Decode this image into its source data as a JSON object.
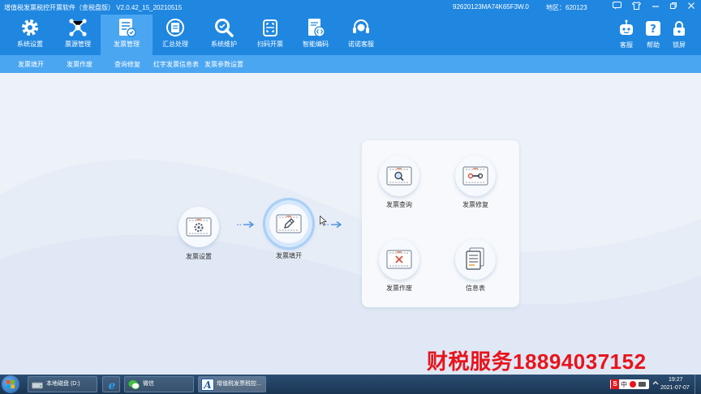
{
  "titlebar": {
    "title": "增值税发票税控开票软件（金税盘版） V2.0.42_15_20210515",
    "tax_id": "92620123MA74K65F3W.0",
    "region": "地区：620123"
  },
  "toolbar": {
    "items": [
      {
        "label": "系统设置",
        "icon": "gear-icon"
      },
      {
        "label": "票源管理",
        "icon": "network-icon"
      },
      {
        "label": "发票管理",
        "icon": "invoice-icon"
      },
      {
        "label": "汇总处理",
        "icon": "summary-icon"
      },
      {
        "label": "系统维护",
        "icon": "wrench-icon"
      },
      {
        "label": "扫码开票",
        "icon": "scan-icon"
      },
      {
        "label": "智能编码",
        "icon": "code-icon"
      },
      {
        "label": "诺诺客服",
        "icon": "headset-icon"
      }
    ],
    "right": [
      {
        "label": "客服",
        "icon": "robot-icon"
      },
      {
        "label": "帮助",
        "icon": "help-icon"
      },
      {
        "label": "锁屏",
        "icon": "lock-icon"
      }
    ]
  },
  "submenu": [
    "发票填开",
    "发票作废",
    "查询修复",
    "红字发票信息表",
    "发票参数设置"
  ],
  "flow": {
    "settings": "发票设置",
    "fill": "发票填开",
    "query": "发票查询",
    "repair": "发票修复",
    "void": "发票作废",
    "info": "信息表"
  },
  "watermark": "财税服务18894037152",
  "taskbar": {
    "tasks": [
      "本地磁盘 (D:)",
      "微信",
      "增值税发票税控..."
    ],
    "lang": "中",
    "time": "19:27",
    "date": "2021-07-07"
  },
  "colors": {
    "primary": "#1f87e0",
    "submenu": "#4aa6f1",
    "watermark": "#e8141c"
  }
}
